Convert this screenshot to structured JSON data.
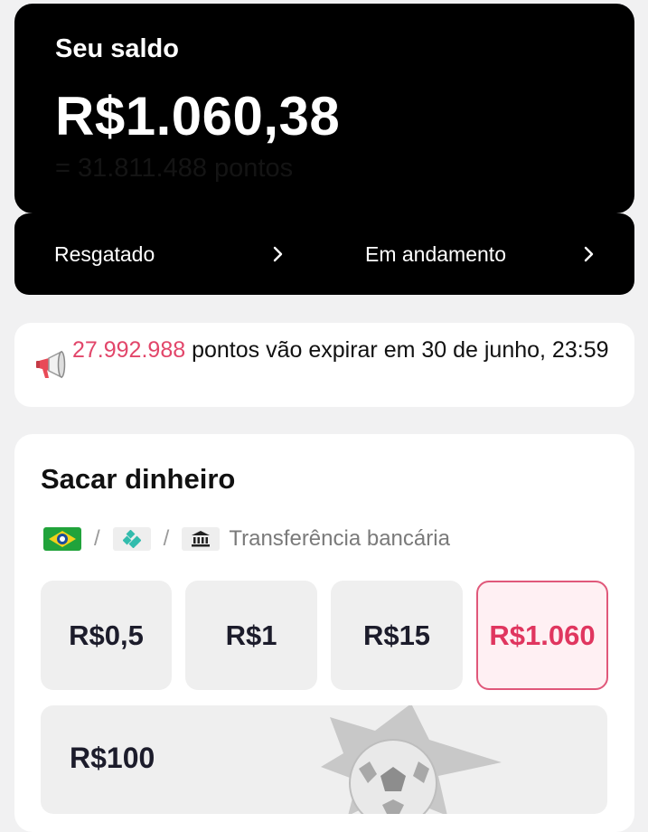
{
  "balance": {
    "label": "Seu saldo",
    "amount": "R$1.060,38",
    "points": "= 31.811.488 pontos"
  },
  "actions": [
    {
      "label": "Resgatado",
      "icon": "chevron-right-icon"
    },
    {
      "label": "Em andamento",
      "icon": "chevron-right-icon"
    }
  ],
  "expiry": {
    "icon": "megaphone-icon",
    "points": "27.992.988",
    "text": " pontos vão expirar em 30 de junho, 23:59",
    "points_color": "#e2466a"
  },
  "withdraw": {
    "title": "Sacar dinheiro",
    "methods": [
      {
        "icon": "pix-brazil-icon"
      },
      {
        "icon": "pix-icon"
      },
      {
        "icon": "bank-icon",
        "label": "Transferência bancária"
      }
    ],
    "separator": "/",
    "amounts": [
      {
        "label": "R$0,5",
        "selected": false
      },
      {
        "label": "R$1",
        "selected": false
      },
      {
        "label": "R$15",
        "selected": false
      },
      {
        "label": "R$1.060",
        "selected": true
      },
      {
        "label": "R$100",
        "selected": false
      }
    ],
    "accent_color": "#e0365f"
  }
}
